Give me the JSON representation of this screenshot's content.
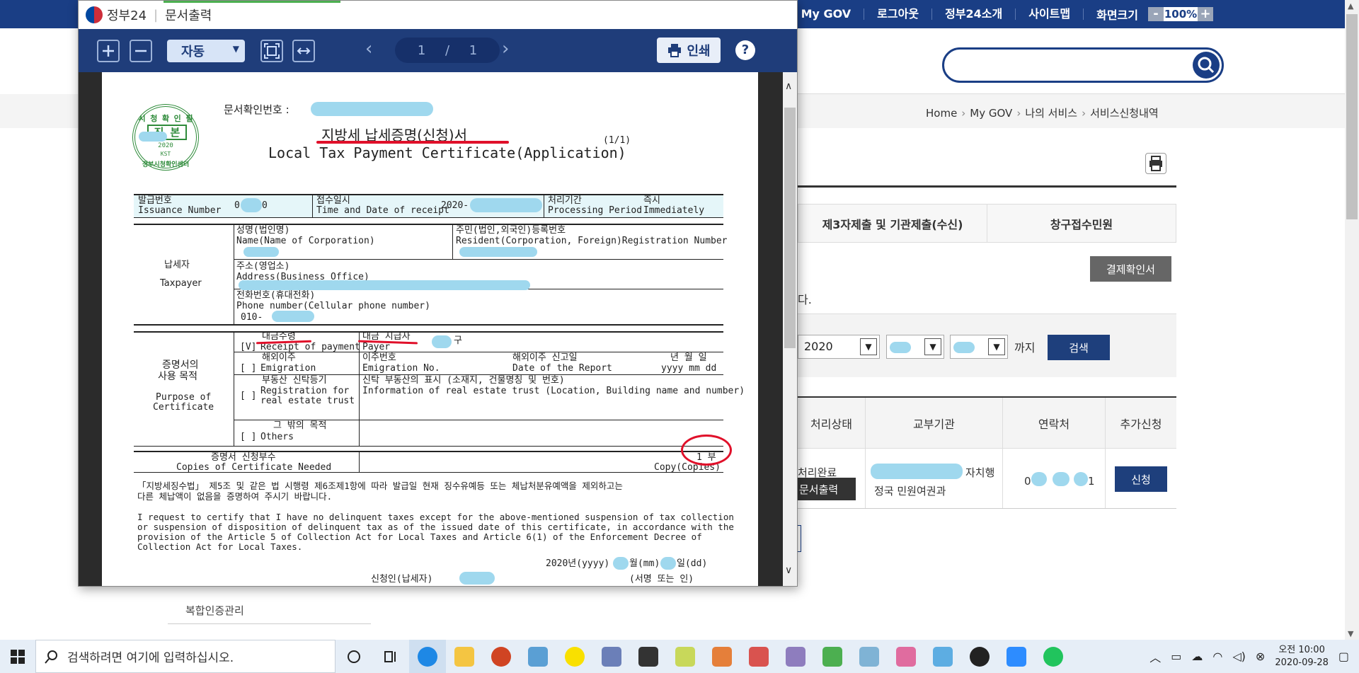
{
  "site": {
    "topnav": [
      "My GOV",
      "로그아웃",
      "정부24소개",
      "사이트맵"
    ],
    "zoom_label": "화면크기",
    "zoom_minus": "-",
    "zoom_value": "100%",
    "zoom_plus": "+",
    "breadcrumb": [
      "Home",
      "My GOV",
      "나의 서비스",
      "서비스신청내역"
    ],
    "tabs": [
      "제3자제출 및 기관제출(수신)",
      "창구접수민원"
    ],
    "payment_confirm": "결제확인서",
    "partial_text": "다.",
    "filter_year": "2020",
    "filter_until": "까지",
    "filter_search": "검색",
    "table_headers": [
      "처리상태",
      "교부기관",
      "연락처",
      "추가신청"
    ],
    "row_status": "처리완료",
    "row_doc_output": "문서출력",
    "row_org_suffix": "자치행",
    "row_org_line2": "정국 민원여권과",
    "row_phone_start": "0",
    "row_phone_end": "1",
    "row_apply": "신청",
    "left_menu_item": "복합인증관리"
  },
  "popup": {
    "brand": "정부24",
    "title": "문서출력",
    "zoom_mode": "자동",
    "page_current": "1",
    "page_sep": "/",
    "page_total": "1",
    "print_label": "인쇄",
    "help_label": "?"
  },
  "document": {
    "stamp_top": "시 청 확 인 필",
    "stamp_center": "진 본",
    "stamp_year": "2020",
    "stamp_code": "KST",
    "stamp_bottom": "정부시청확인센터",
    "doc_confirm_no": "문서확인번호 :",
    "title_ko": "지방세 납세증명(신청)서",
    "title_en": "Local Tax Payment Certificate(Application)",
    "page_indicator": "(1/1)",
    "issuance_ko": "발급번호",
    "issuance_en": "Issuance Number",
    "issuance_val_a": "0",
    "issuance_val_b": "0",
    "receipt_ko": "접수일시",
    "receipt_en": "Time and Date of receipt",
    "receipt_val": "2020-",
    "period_ko": "처리기간",
    "period_en": "Processing Period",
    "period_val_ko": "즉시",
    "period_val_en": "Immediately",
    "taxpayer_ko": "납세자",
    "taxpayer_en": "Taxpayer",
    "name_ko": "성명(법인명)",
    "name_en": "Name(Name of Corporation)",
    "resident_ko": "주민(법인,외국인)등록번호",
    "resident_en": "Resident(Corporation, Foreign)Registration Number",
    "address_ko": "주소(영업소)",
    "address_en": "Address(Business Office)",
    "phone_ko": "전화번호(휴대전화)",
    "phone_en": "Phone number(Cellular phone number)",
    "phone_val": "010-",
    "purpose_ko_1": "증명서의",
    "purpose_ko_2": "사용 목적",
    "purpose_en_1": "Purpose of",
    "purpose_en_2": "Certificate",
    "receipt_payment_ko": "대금수령",
    "receipt_payment_en": "Receipt of payment",
    "receipt_payment_mark": "[V]",
    "payer_ko": "대금 지급자",
    "payer_en": "Payer",
    "payer_suffix": "구",
    "emigration_ko": "해외이주",
    "emigration_en": "Emigration",
    "emigration_mark": "[ ]",
    "emig_no_ko": "이주번호",
    "emig_no_en": "Emigration No.",
    "report_date_ko": "해외이주 신고일",
    "report_date_en": "Date of the Report",
    "ymd_ko": "년 월 일",
    "ymd_en": "yyyy  mm  dd",
    "realestate_ko": "부동산 신탁등기",
    "realestate_en_1": "Registration for",
    "realestate_en_2": "real estate trust",
    "realestate_mark": "[ ]",
    "trust_info_ko": "신탁 부동산의 표시 (소재지, 건물명칭 및 번호)",
    "trust_info_en": "Information of real estate trust (Location, Building name and number)",
    "others_ko": "그 밖의 목적",
    "others_en": "Others",
    "others_mark": "[ ]",
    "copies_ko": "증명서 신청부수",
    "copies_en": "Copies of Certificate Needed",
    "copies_val": "1 부",
    "copies_unit": "Copy(Copies)",
    "law_ko_1": "「지방세징수법」 제5조 및 같은 법 시행령 제6조제1항에 따라 발급일 현재 징수유예등 또는 체납처분유예액을 제외하고는",
    "law_ko_2": "다른 체납액이 없음을 증명하여 주시기 바랍니다.",
    "law_en_1": "  I request to certify that I have no delinquent taxes except for the above-mentioned suspension of tax collection",
    "law_en_2": "or suspension of disposition of delinquent tax as of the issued date of this certificate, in accordance with the",
    "law_en_3": "provision of the Article 5 of Collection Act for Local Taxes and Article 6(1) of the Enforcement Decree of",
    "law_en_4": "Collection Act for Local Taxes.",
    "date_year": "2020년(yyyy)",
    "date_month": "월(mm)",
    "date_day": "일(dd)",
    "applicant": "신청인(납세자)",
    "sign": "(서명 또는 인)"
  },
  "taskbar": {
    "search_placeholder": "검색하려면 여기에 입력하십시오.",
    "time": "오전 10:00",
    "date": "2020-09-28"
  },
  "colors": {
    "gov_blue": "#1a3e85",
    "toolbar": "#1f3d7a",
    "redaction": "#9fd8ee",
    "annotation_red": "#e0102a",
    "stamp_green": "#2e8b3a"
  }
}
